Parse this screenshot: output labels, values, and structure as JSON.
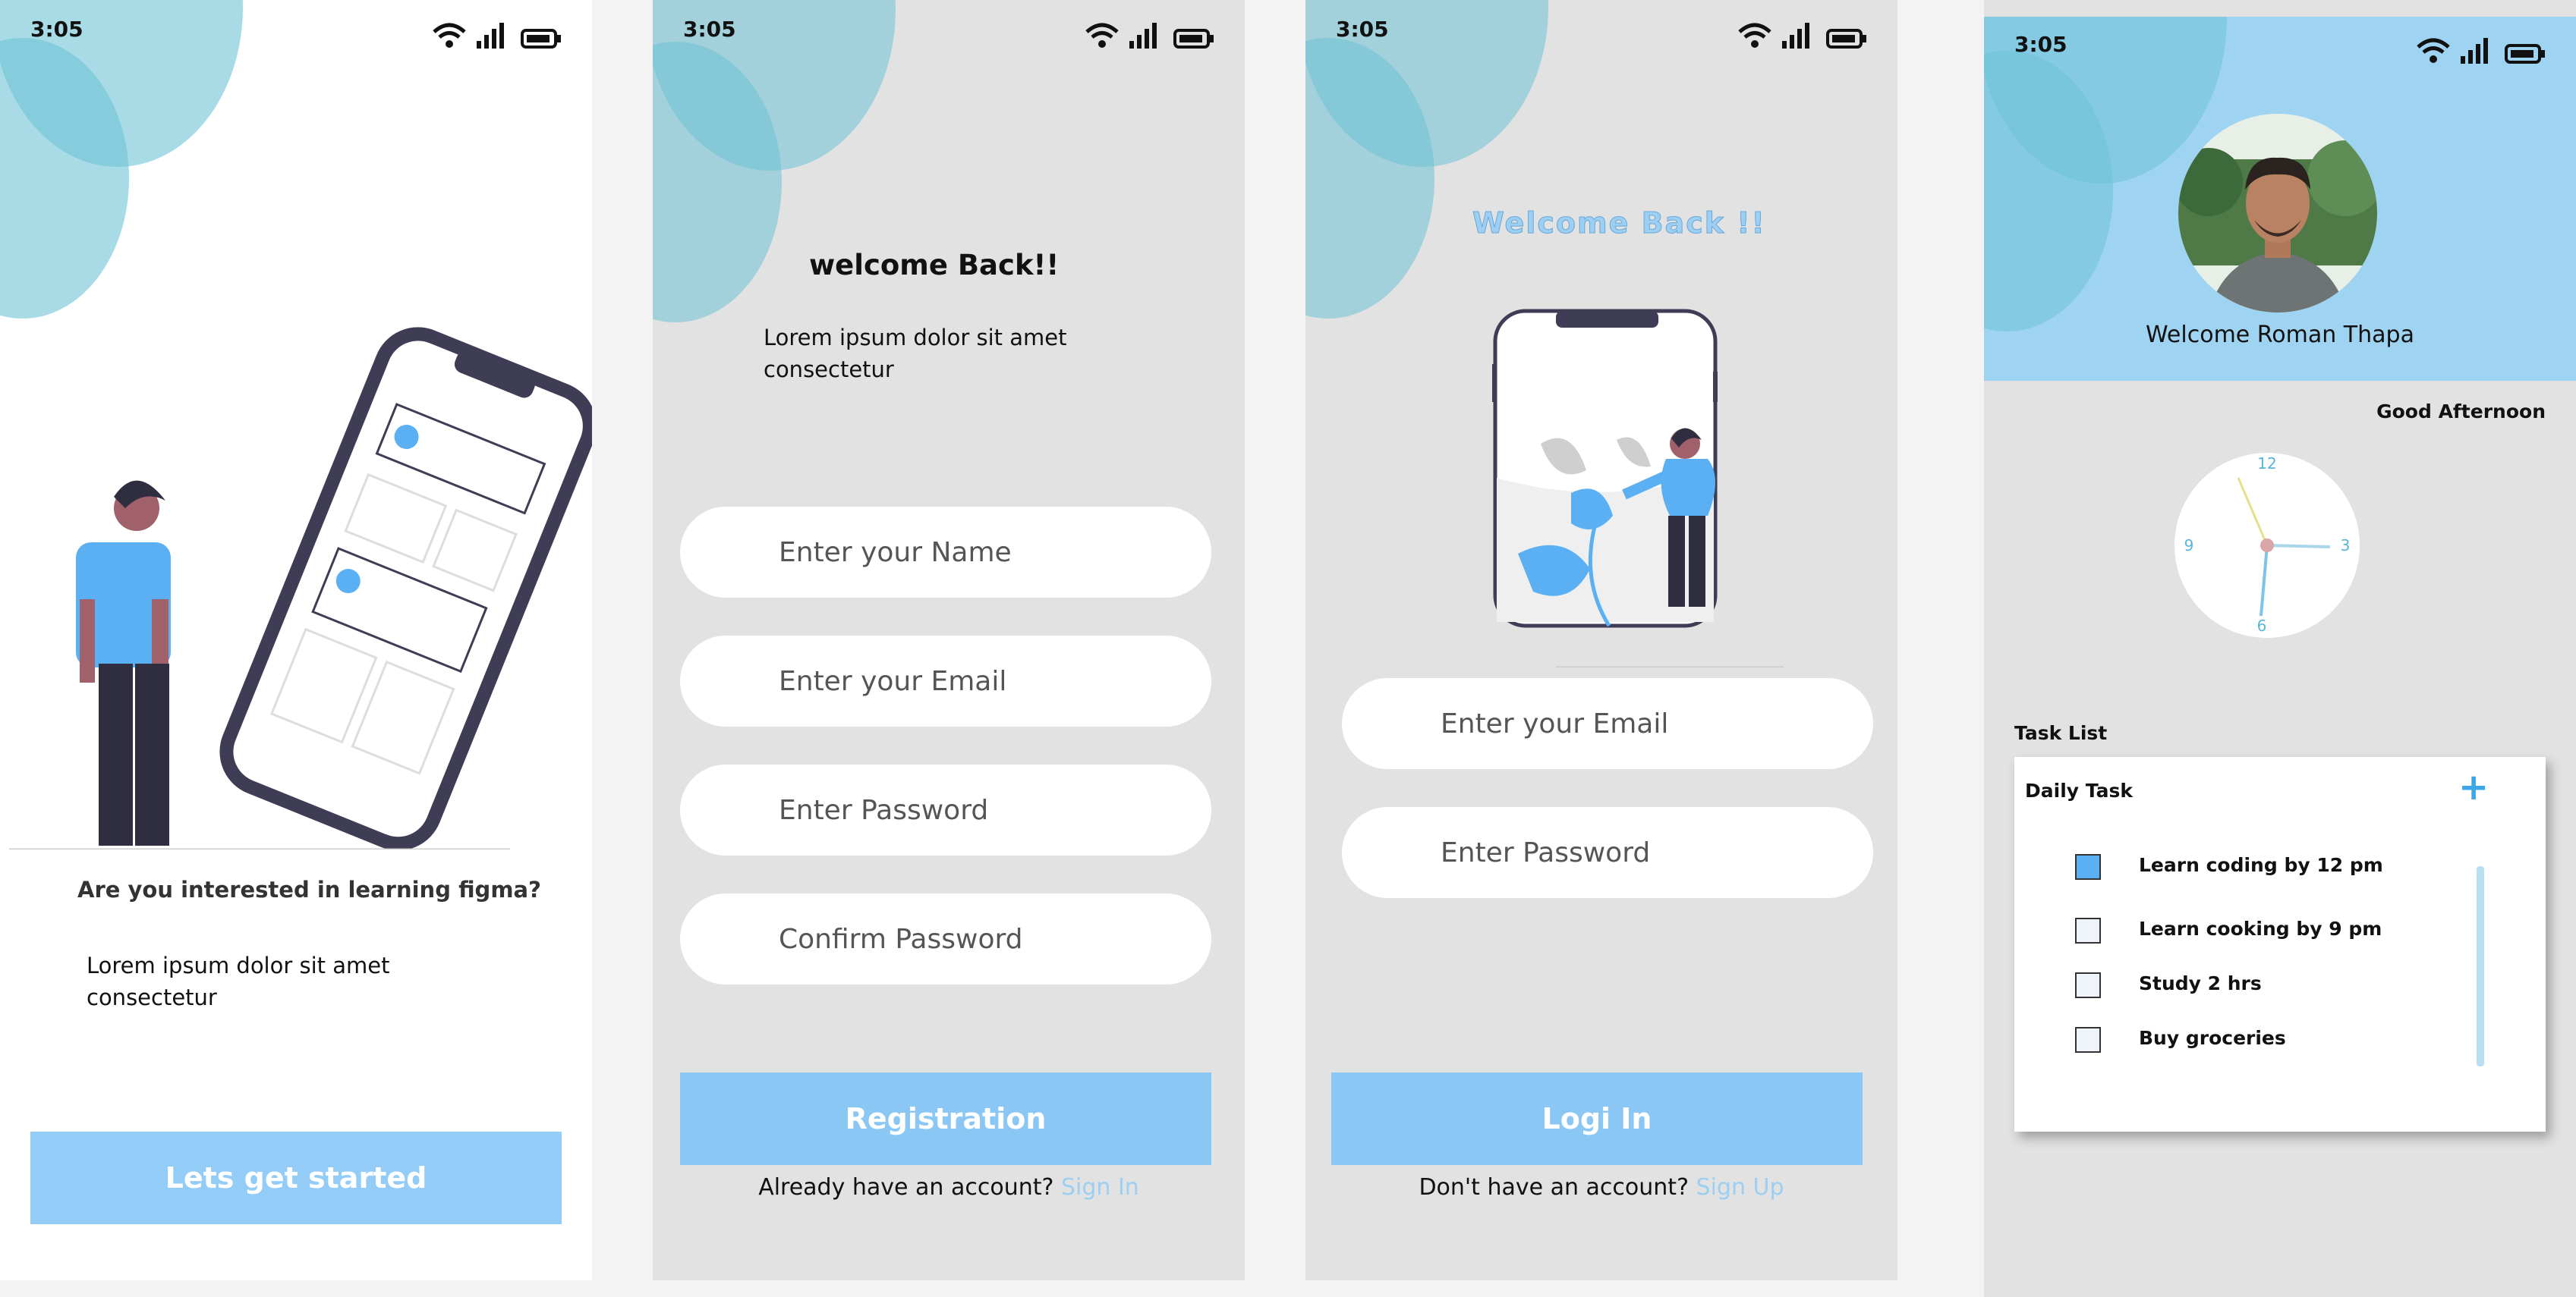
{
  "status": {
    "time": "3:05"
  },
  "onboarding": {
    "question": "Are you interested in learning figma?",
    "body": "Lorem ipsum dolor sit amet consectetur",
    "cta": "Lets get started"
  },
  "register": {
    "heading": "welcome Back!!",
    "body": "Lorem ipsum dolor sit amet consectetur",
    "fields": [
      {
        "placeholder": "Enter your Name"
      },
      {
        "placeholder": "Enter your Email"
      },
      {
        "placeholder": "Enter Password"
      },
      {
        "placeholder": "Confirm Password"
      }
    ],
    "cta": "Registration",
    "footer_text": "Already have an account?",
    "footer_link": "Sign In"
  },
  "login": {
    "heading": "Welcome Back !!",
    "fields": [
      {
        "placeholder": "Enter your Email"
      },
      {
        "placeholder": "Enter Password"
      }
    ],
    "cta": "Logi In",
    "footer_text": "Don't have an account?",
    "footer_link": "Sign Up"
  },
  "dashboard": {
    "welcome": "Welcome Roman Thapa",
    "greeting": "Good Afternoon",
    "clock": {
      "n12": "12",
      "n3": "3",
      "n6": "6",
      "n9": "9"
    },
    "task_list_label": "Task List",
    "card_title": "Daily Task",
    "add_symbol": "+",
    "tasks": [
      {
        "label": "Learn coding by 12 pm",
        "checked": true
      },
      {
        "label": "Learn cooking by 9 pm",
        "checked": false
      },
      {
        "label": "Study 2 hrs",
        "checked": false
      },
      {
        "label": "Buy groceries",
        "checked": false
      }
    ]
  },
  "colors": {
    "accent": "#8ac7f5",
    "blob": "#6ec3d6",
    "header": "#9fd3f2",
    "link": "#9ccff2"
  }
}
